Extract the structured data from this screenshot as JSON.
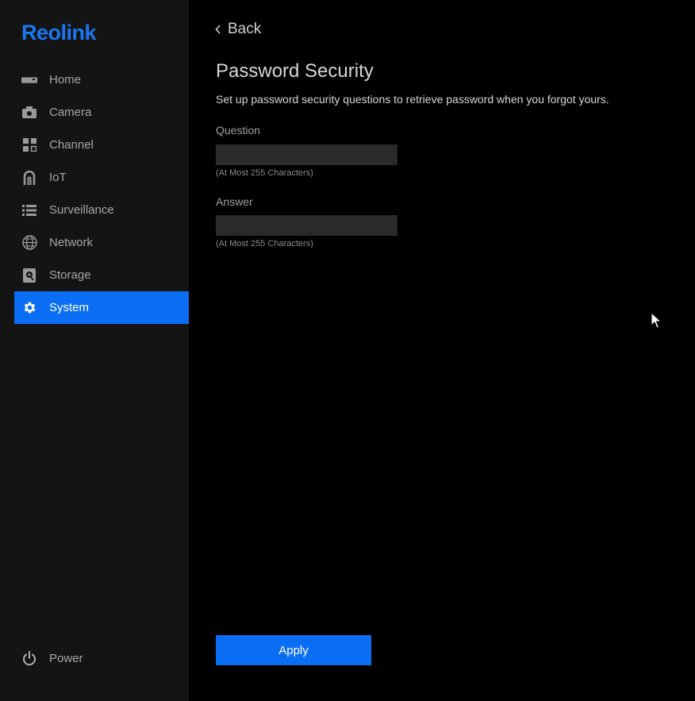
{
  "brand": {
    "logo_text": "Reolink",
    "accent_color": "#1877f2"
  },
  "sidebar": {
    "items": [
      {
        "label": "Home",
        "icon": "home-device-icon"
      },
      {
        "label": "Camera",
        "icon": "camera-icon"
      },
      {
        "label": "Channel",
        "icon": "channel-grid-icon"
      },
      {
        "label": "IoT",
        "icon": "iot-icon"
      },
      {
        "label": "Surveillance",
        "icon": "list-icon"
      },
      {
        "label": "Network",
        "icon": "globe-icon"
      },
      {
        "label": "Storage",
        "icon": "storage-icon"
      },
      {
        "label": "System",
        "icon": "gear-icon",
        "active": true
      }
    ],
    "power_label": "Power"
  },
  "header": {
    "back_label": "Back"
  },
  "main": {
    "title": "Password Security",
    "description": "Set up password security questions to retrieve password when you forgot yours.",
    "question": {
      "label": "Question",
      "value": "",
      "hint": "(At Most 255 Characters)"
    },
    "answer": {
      "label": "Answer",
      "value": "",
      "hint": "(At Most 255 Characters)"
    },
    "apply_label": "Apply"
  }
}
